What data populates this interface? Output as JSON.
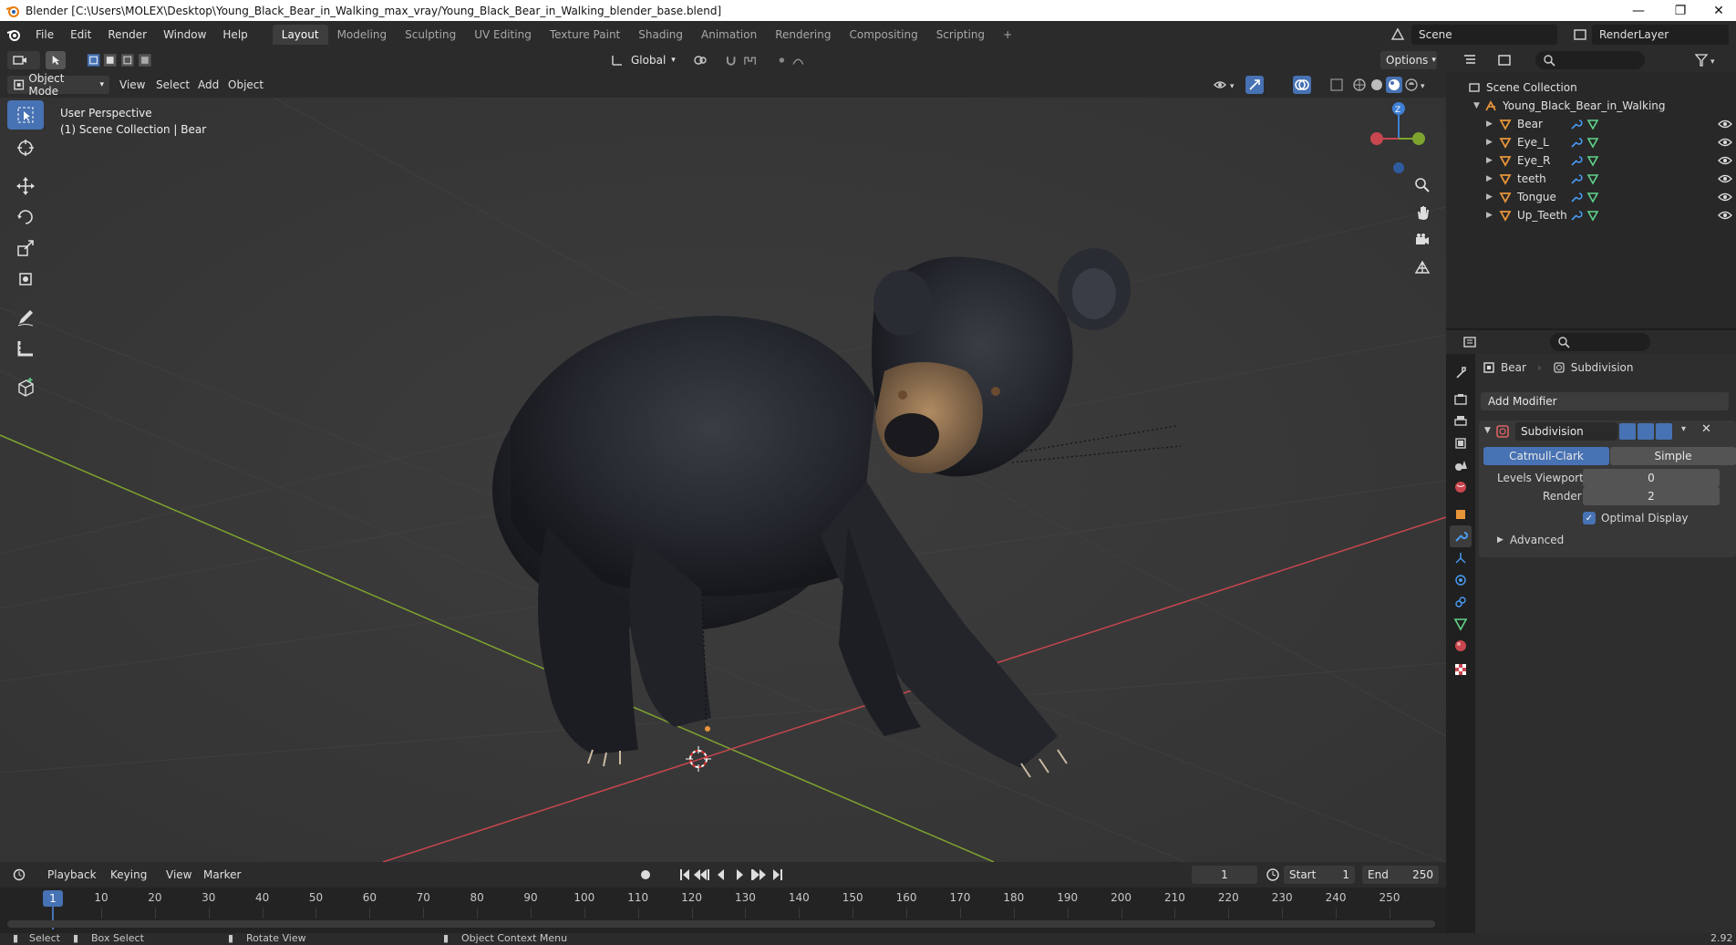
{
  "titlebar": {
    "title": "Blender [C:\\Users\\MOLEX\\Desktop\\Young_Black_Bear_in_Walking_max_vray/Young_Black_Bear_in_Walking_blender_base.blend]",
    "minimize": "—",
    "maximize": "❐",
    "close": "✕"
  },
  "menu": [
    "File",
    "Edit",
    "Render",
    "Window",
    "Help"
  ],
  "workspaces": [
    "Layout",
    "Modeling",
    "Sculpting",
    "UV Editing",
    "Texture Paint",
    "Shading",
    "Animation",
    "Rendering",
    "Compositing",
    "Scripting"
  ],
  "workspace_add": "+",
  "scene": {
    "name": "Scene",
    "render_layer": "RenderLayer"
  },
  "toolheader": {
    "orientation": "Global",
    "options": "Options"
  },
  "viewport_header": {
    "mode": "Object Mode",
    "items": [
      "View",
      "Select",
      "Add",
      "Object"
    ]
  },
  "viewport": {
    "perspective": "User Perspective",
    "collection": "(1) Scene Collection | Bear",
    "gizmo_z": "Z"
  },
  "timeline": {
    "menus": [
      "Playback",
      "Keying",
      "View",
      "Marker"
    ],
    "current_frame": "1",
    "start_label": "Start",
    "start": "1",
    "end_label": "End",
    "end": "250",
    "ticks": [
      "1",
      "10",
      "20",
      "30",
      "40",
      "50",
      "60",
      "70",
      "80",
      "90",
      "100",
      "110",
      "120",
      "130",
      "140",
      "150",
      "160",
      "170",
      "180",
      "190",
      "200",
      "210",
      "220",
      "230",
      "240",
      "250"
    ]
  },
  "statusbar": {
    "select": "Select",
    "box_select": "Box Select",
    "rotate": "Rotate View",
    "context": "Object Context Menu",
    "version": "2.92"
  },
  "outliner": {
    "root": "Scene Collection",
    "collection": "Young_Black_Bear_in_Walking",
    "objects": [
      "Bear",
      "Eye_L",
      "Eye_R",
      "teeth",
      "Tongue",
      "Up_Teeth"
    ]
  },
  "properties": {
    "breadcrumb_object": "Bear",
    "breadcrumb_modifier": "Subdivision",
    "add_modifier": "Add Modifier",
    "modifier_name": "Subdivision",
    "catmull": "Catmull-Clark",
    "simple": "Simple",
    "levels_viewport_label": "Levels Viewport",
    "levels_viewport": "0",
    "render_label": "Render",
    "render": "2",
    "optimal_display": "Optimal Display",
    "optimal_display_checked": true,
    "advanced": "Advanced"
  },
  "colors": {
    "accent": "#4772b3",
    "x_axis": "#c8464f",
    "y_axis": "#7ea32f",
    "z_axis": "#3f7fd6",
    "object_orange": "#e8953a",
    "mesh_green": "#5fd38a"
  }
}
